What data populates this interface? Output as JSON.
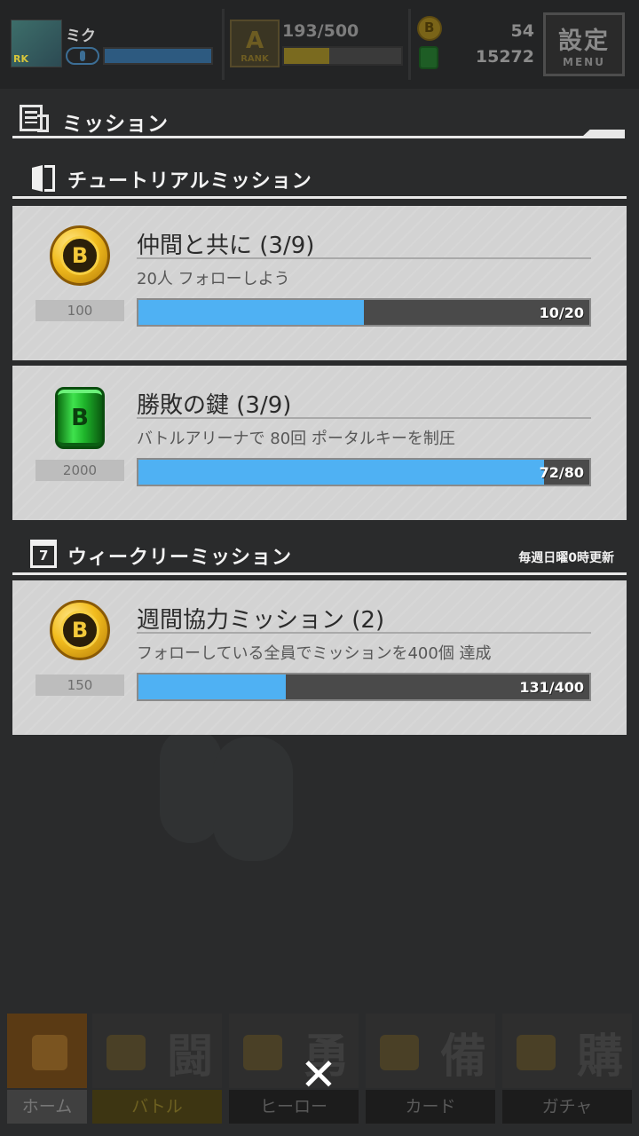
{
  "status_bar": {
    "player_name": "ミク",
    "avatar_level_tag": "RK",
    "rank_label": "RANK",
    "rank_glyph": "A",
    "stamina_text": "193/500",
    "stamina_fraction": 0.39,
    "coins": "54",
    "keys": "15272",
    "settings_label": "設定",
    "menu_label": "MENU"
  },
  "mission_header": {
    "title": "ミッション"
  },
  "tutorial_section": {
    "title": "チュートリアルミッション",
    "missions": [
      {
        "icon": "gold-coin-icon",
        "reward": "100",
        "title": "仲間と共に (3/9)",
        "description": "20人 フォローしよう",
        "progress_text": "10/20",
        "progress_fraction": 0.5
      },
      {
        "icon": "green-canister-icon",
        "reward": "2000",
        "title": "勝敗の鍵 (3/9)",
        "description": "バトルアリーナで 80回 ポータルキーを制圧",
        "progress_text": "72/80",
        "progress_fraction": 0.9
      }
    ]
  },
  "weekly_section": {
    "title": "ウィークリーミッション",
    "reset_note": "毎週日曜0時更新",
    "missions": [
      {
        "icon": "gold-coin-icon",
        "reward": "150",
        "title": "週間協力ミッション (2)",
        "description": "フォローしている全員でミッションを400個 達成",
        "progress_text": "131/400",
        "progress_fraction": 0.3275
      }
    ]
  },
  "bottom_nav": [
    {
      "label": "ホーム",
      "kanji": ""
    },
    {
      "label": "バトル",
      "kanji": "闘"
    },
    {
      "label": "ヒーロー",
      "kanji": "勇"
    },
    {
      "label": "カード",
      "kanji": "備"
    },
    {
      "label": "ガチャ",
      "kanji": "購"
    }
  ],
  "close_glyph": "✕",
  "coin_glyph": "B",
  "can_glyph": "B",
  "colors": {
    "progress_fill": "#4fb1f3",
    "card_bg": "#d3d3d3",
    "page_bg": "#2a2b2c"
  }
}
